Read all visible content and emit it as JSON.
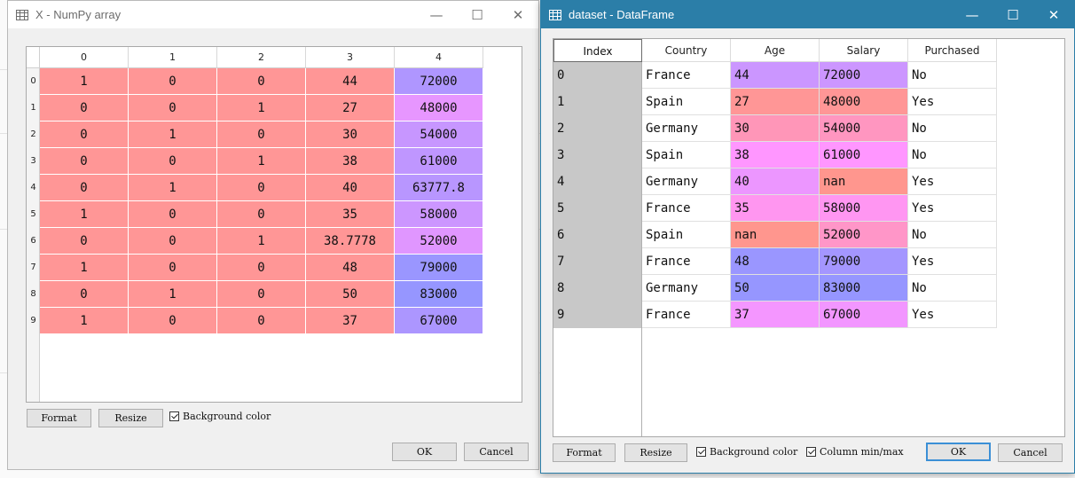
{
  "numpy_window": {
    "title": "X - NumPy array",
    "columns": [
      "0",
      "1",
      "2",
      "3",
      "4"
    ],
    "row_labels": [
      "0",
      "1",
      "2",
      "3",
      "4",
      "5",
      "6",
      "7",
      "8",
      "9"
    ],
    "rows": [
      [
        "1",
        "0",
        "0",
        "44",
        "72000"
      ],
      [
        "0",
        "0",
        "1",
        "27",
        "48000"
      ],
      [
        "0",
        "1",
        "0",
        "30",
        "54000"
      ],
      [
        "0",
        "0",
        "1",
        "38",
        "61000"
      ],
      [
        "0",
        "1",
        "0",
        "40",
        "63777.8"
      ],
      [
        "1",
        "0",
        "0",
        "35",
        "58000"
      ],
      [
        "0",
        "0",
        "1",
        "38.7778",
        "52000"
      ],
      [
        "1",
        "0",
        "0",
        "48",
        "79000"
      ],
      [
        "0",
        "1",
        "0",
        "50",
        "83000"
      ],
      [
        "1",
        "0",
        "0",
        "37",
        "67000"
      ]
    ],
    "cell_colors": [
      [
        "#ff9696",
        "#ff9696",
        "#ff9696",
        "#ff9696",
        "#af96ff"
      ],
      [
        "#ff9696",
        "#ff9696",
        "#ff9696",
        "#ff9696",
        "#e796ff"
      ],
      [
        "#ff9696",
        "#ff9696",
        "#ff9696",
        "#ff9696",
        "#c796ff"
      ],
      [
        "#ff9696",
        "#ff9696",
        "#ff9696",
        "#ff9696",
        "#bf96ff"
      ],
      [
        "#ff9696",
        "#ff9696",
        "#ff9696",
        "#ff9696",
        "#b896ff"
      ],
      [
        "#ff9696",
        "#ff9696",
        "#ff9696",
        "#ff9696",
        "#cc96ff"
      ],
      [
        "#ff9696",
        "#ff9696",
        "#ff9696",
        "#ff9696",
        "#e096ff"
      ],
      [
        "#ff9696",
        "#ff9696",
        "#ff9696",
        "#ff9696",
        "#9a96ff"
      ],
      [
        "#ff9696",
        "#ff9696",
        "#ff9696",
        "#ff9696",
        "#9696ff"
      ],
      [
        "#ff9696",
        "#ff9696",
        "#ff9696",
        "#ff9696",
        "#ac96ff"
      ]
    ],
    "format_label": "Format",
    "resize_label": "Resize",
    "bg_color_label": "Background color",
    "ok_label": "OK",
    "cancel_label": "Cancel"
  },
  "df_window": {
    "title": "dataset - DataFrame",
    "index_header": "Index",
    "columns": [
      "Country",
      "Age",
      "Salary",
      "Purchased"
    ],
    "index": [
      "0",
      "1",
      "2",
      "3",
      "4",
      "5",
      "6",
      "7",
      "8",
      "9"
    ],
    "rows": [
      [
        "France",
        "44",
        "72000",
        "No"
      ],
      [
        "Spain",
        "27",
        "48000",
        "Yes"
      ],
      [
        "Germany",
        "30",
        "54000",
        "No"
      ],
      [
        "Spain",
        "38",
        "61000",
        "No"
      ],
      [
        "Germany",
        "40",
        "nan",
        "Yes"
      ],
      [
        "France",
        "35",
        "58000",
        "Yes"
      ],
      [
        "Spain",
        "nan",
        "52000",
        "No"
      ],
      [
        "France",
        "48",
        "79000",
        "Yes"
      ],
      [
        "Germany",
        "50",
        "83000",
        "No"
      ],
      [
        "France",
        "37",
        "67000",
        "Yes"
      ]
    ],
    "cell_colors": [
      [
        "#ffffff",
        "#cb96ff",
        "#cc96ff",
        "#ffffff"
      ],
      [
        "#ffffff",
        "#ff9696",
        "#ff9696",
        "#ffffff"
      ],
      [
        "#ffffff",
        "#ff96b8",
        "#ff96c0",
        "#ffffff"
      ],
      [
        "#ffffff",
        "#ff96ff",
        "#ff96ff",
        "#ffffff"
      ],
      [
        "#ffffff",
        "#ec96ff",
        "#ff968e",
        "#ffffff"
      ],
      [
        "#ffffff",
        "#ff96f0",
        "#ff96f2",
        "#ffffff"
      ],
      [
        "#ffffff",
        "#ff968e",
        "#ff96c8",
        "#ffffff"
      ],
      [
        "#ffffff",
        "#9a96ff",
        "#a496ff",
        "#ffffff"
      ],
      [
        "#ffffff",
        "#9696ff",
        "#9696ff",
        "#ffffff"
      ],
      [
        "#ffffff",
        "#f496ff",
        "#f296ff",
        "#ffffff"
      ]
    ],
    "format_label": "Format",
    "resize_label": "Resize",
    "bg_color_label": "Background color",
    "col_minmax_label": "Column min/max",
    "ok_label": "OK",
    "cancel_label": "Cancel"
  },
  "window_controls": {
    "minimize": "—",
    "maximize": "☐",
    "close": "✕"
  }
}
